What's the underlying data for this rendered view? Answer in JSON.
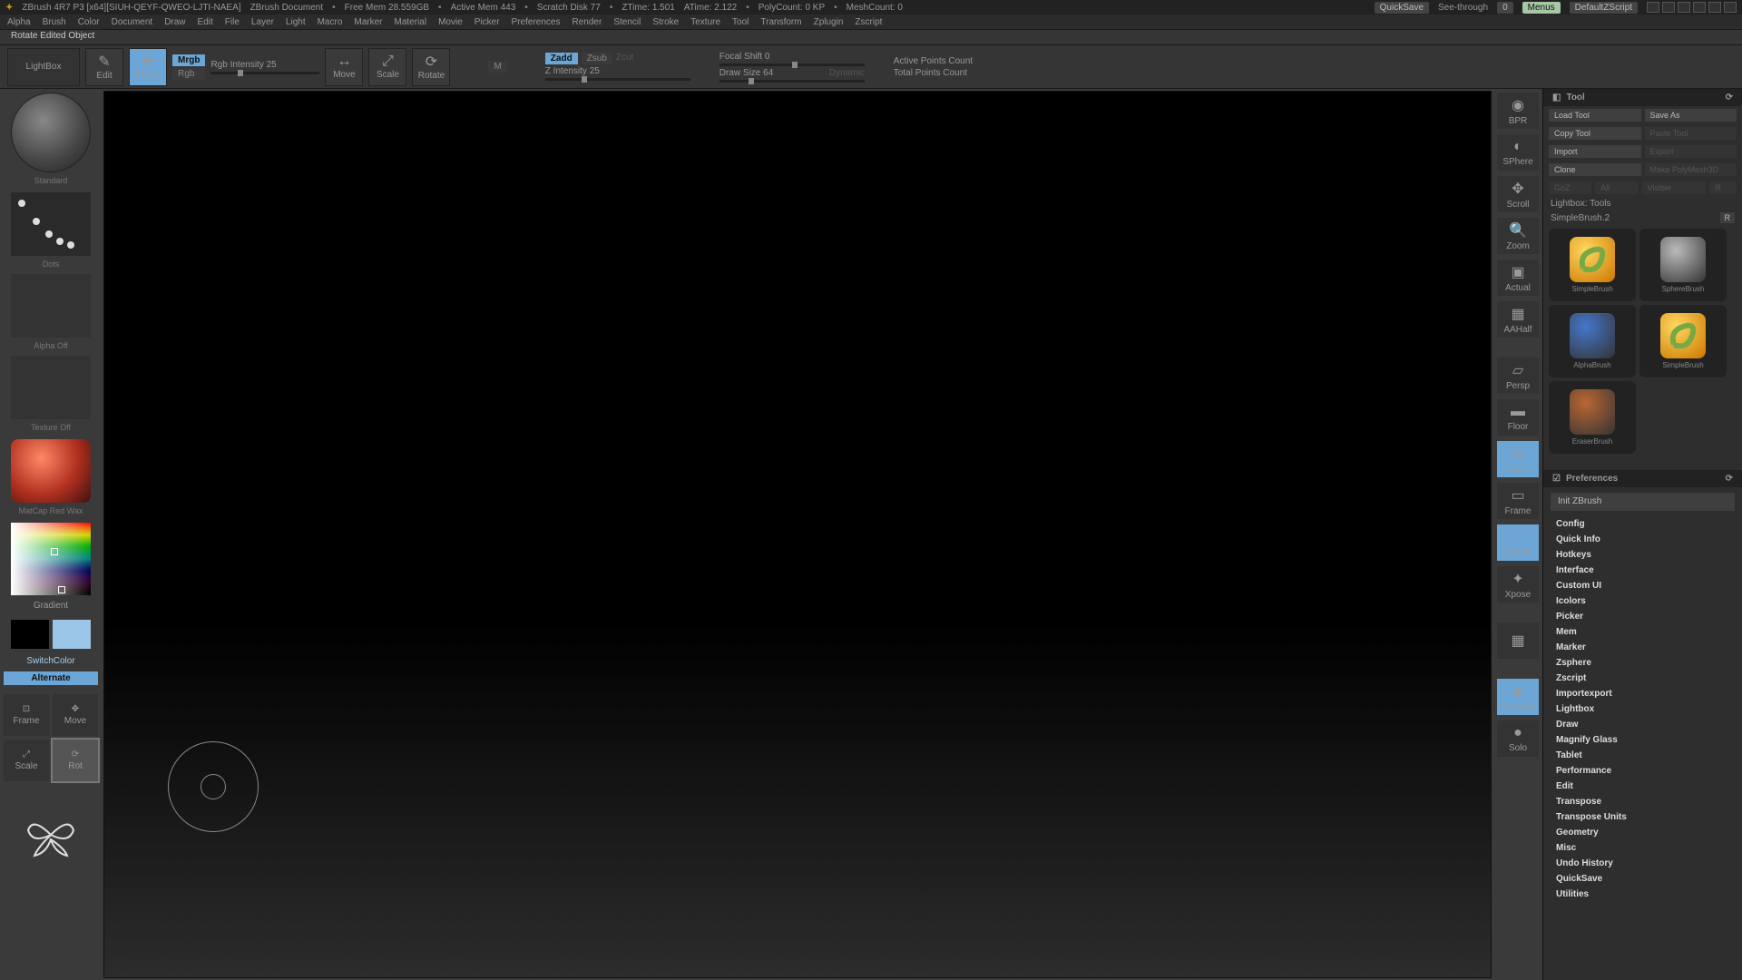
{
  "title": {
    "app": "ZBrush 4R7 P3 [x64][SIUH-QEYF-QWEO-LJTI-NAEA]",
    "doc": "ZBrush Document",
    "free_mem": "Free Mem 28.559GB",
    "active_mem": "Active Mem 443",
    "scratch": "Scratch Disk 77",
    "ztime": "ZTime: 1.501",
    "atime": "ATime: 2.122",
    "polycount": "PolyCount: 0  KP",
    "meshcount": "MeshCount: 0",
    "quicksave": "QuickSave",
    "see_through": "See-through",
    "see_through_val": "0",
    "menus": "Menus",
    "script": "DefaultZScript"
  },
  "menu": [
    "Alpha",
    "Brush",
    "Color",
    "Document",
    "Draw",
    "Edit",
    "File",
    "Layer",
    "Light",
    "Macro",
    "Marker",
    "Material",
    "Movie",
    "Picker",
    "Preferences",
    "Render",
    "Stencil",
    "Stroke",
    "Texture",
    "Tool",
    "Transform",
    "Zplugin",
    "Zscript"
  ],
  "status": "Rotate Edited Object",
  "toolbar": {
    "lightbox": "LightBox",
    "edit": "Edit",
    "draw": "Draw",
    "mrgb": "Mrgb",
    "rgb": "Rgb",
    "m": "M",
    "rgb_intensity": "Rgb Intensity 25",
    "move": "Move",
    "scale": "Scale",
    "rotate": "Rotate",
    "zadd": "Zadd",
    "zsub": "Zsub",
    "zcut": "Zcut",
    "z_intensity": "Z Intensity 25",
    "focal_shift": "Focal Shift 0",
    "draw_size": "Draw Size 64",
    "dynamic": "Dynamic",
    "active_points": "Active Points Count",
    "total_points": "Total Points Count"
  },
  "left": {
    "standard": "Standard",
    "dots": "Dots",
    "alpha_off": "Alpha Off",
    "texture_off": "Texture Off",
    "material": "MatCap Red Wax",
    "gradient": "Gradient",
    "switchcolor": "SwitchColor",
    "alternate": "Alternate",
    "frame": "Frame",
    "move": "Move",
    "scale": "Scale",
    "rot": "Rot"
  },
  "rdock": {
    "bpr": "BPR",
    "sphere": "SPhere",
    "scroll": "Scroll",
    "zoom": "Zoom",
    "actual": "Actual",
    "aahalf": "AAHalf",
    "persp": "Persp",
    "floor": "Floor",
    "local": "Local",
    "frame": "Frame",
    "ghost": "Ghost",
    "xpose": "Xpose",
    "dynamic": "Dynamic",
    "solo": "Solo"
  },
  "tool": {
    "header": "Tool",
    "load": "Load Tool",
    "save_as": "Save As",
    "copy": "Copy Tool",
    "paste": "Paste Tool",
    "import": "Import",
    "export": "Export",
    "clone": "Clone",
    "make_polymesh": "Make PolyMesh3D",
    "goz": "GoZ",
    "all": "All",
    "visible": "Visible",
    "r": "R",
    "lightbox_tools": "Lightbox: Tools",
    "active": "SimpleBrush.2",
    "thumbs": [
      {
        "label": "SimpleBrush",
        "color": "#e6a815"
      },
      {
        "label": "SphereBrush",
        "color": "#bbb"
      },
      {
        "label": "AlphaBrush",
        "color": "#4477cc"
      },
      {
        "label": "SimpleBrush",
        "color": "#e6a815"
      },
      {
        "label": "EraserBrush",
        "color": "#bb6633"
      }
    ]
  },
  "prefs": {
    "header": "Preferences",
    "init": "Init ZBrush",
    "cats": [
      "Config",
      "Quick Info",
      "Hotkeys",
      "Interface",
      "Custom UI",
      "Icolors",
      "Picker",
      "Mem",
      "Marker",
      "Zsphere",
      "Zscript",
      "Importexport",
      "Lightbox",
      "Draw",
      "Magnify Glass",
      "Tablet",
      "Performance",
      "Edit",
      "Transpose",
      "Transpose Units",
      "Geometry",
      "Misc",
      "Undo History",
      "QuickSave",
      "Utilities"
    ]
  }
}
